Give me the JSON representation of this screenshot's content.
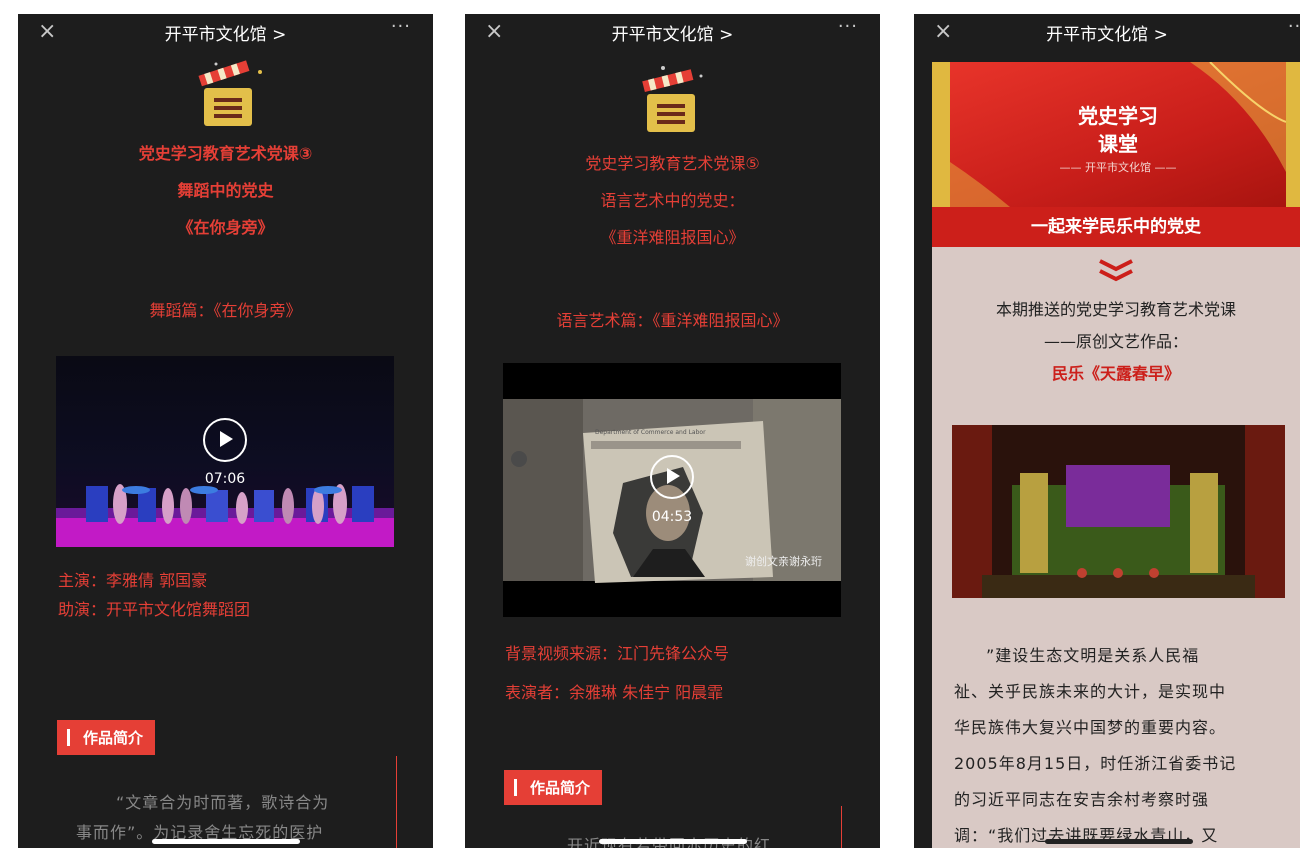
{
  "nav": {
    "title": "开平市文化馆 >",
    "close_icon": "×",
    "more_icon": "···"
  },
  "panel1": {
    "heading1": "党史学习教育艺术党课③",
    "heading2": "舞蹈中的党史",
    "heading3": "《在你身旁》",
    "section": "舞蹈篇：《在你身旁》",
    "video_duration": "07:06",
    "credits1": "主演：李雅倩 郭国豪",
    "credits2": "助演：开平市文化馆舞蹈团",
    "badge": "作品简介",
    "para_line1": "“文章合为时而著，歌诗合为",
    "para_line2": "事而作”。为记录舍生忘死的医护"
  },
  "panel2": {
    "heading1": "党史学习教育艺术党课⑤",
    "heading2": "语言艺术中的党史：",
    "heading3": "《重洋难阻报国心》",
    "section": "语言艺术篇：《重洋难阻报国心》",
    "video_duration": "04:53",
    "video_caption": "谢创文亲谢永珩",
    "doc_text": "Department of Commerce and Labor",
    "credits1": "背景视频来源：江门先锋公众号",
    "credits2": "表演者：余雅琳 朱佳宁 阳晨霏",
    "badge": "作品简介",
    "para_line1": "开近现有若带回赤历史的红"
  },
  "panel3": {
    "banner_title1": "党史学习",
    "banner_title2": "课堂",
    "banner_sub": "—— 开平市文化馆 ——",
    "redbar": "一起来学民乐中的党史",
    "intro1": "本期推送的党史学习教育艺术党课",
    "intro2": "——原创文艺作品：",
    "intro3": "民乐《天露春早》",
    "para": [
      "”建设生态文明是关系人民福",
      "祉、关乎民族未来的大计，是实现中",
      "华民族伟大复兴中国梦的重要内容。",
      "2005年8月15日，时任浙江省委书记",
      "的习近平同志在安吉余村考察时强",
      "调：“我们过去讲既要绿水青山，又"
    ]
  },
  "colors": {
    "accent": "#e53f36",
    "background": "#1d1d1d",
    "panel3_bg": "#d9c9c5"
  }
}
